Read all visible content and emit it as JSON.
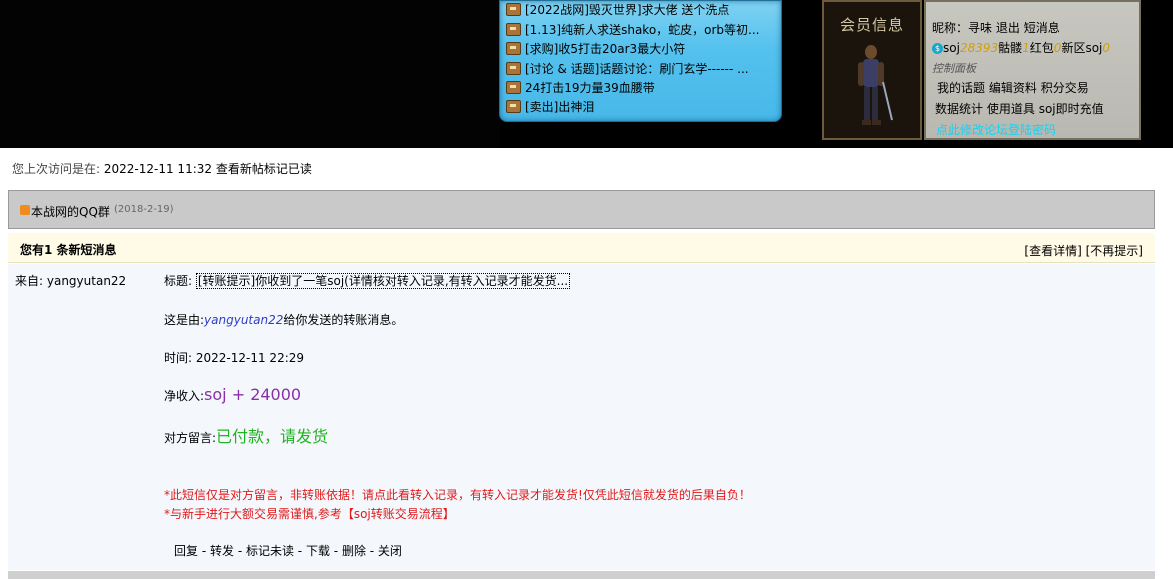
{
  "news": {
    "items": [
      "[2022战网]毁灭世界]求大佬 送个洗点",
      "[1.13]纯新人求送shako，蛇皮，orb等初...",
      "[求购]收5打击20ar3最大小符",
      "[讨论 & 话题]话题讨论：刷门玄学------ ...",
      "24打击19力量39血腰带",
      "[卖出]出神泪"
    ]
  },
  "member_panel": {
    "title": "会员信息",
    "nickname_label": "昵称：",
    "nickname": "寻味",
    "logout": "退出",
    "messages": "短消息",
    "soj_label": "soj",
    "soj_value": "28393",
    "skull_label": "骷髅",
    "skull_value": "1",
    "hongbao_label": "红包",
    "hongbao_value": "0",
    "newzone_label": "新区soj",
    "newzone_value": "0",
    "control_label": "控制面板",
    "links_row1": [
      "我的话题",
      "编辑资料",
      "积分交易"
    ],
    "links_row2": [
      "数据统计",
      "使用道具",
      "soj即时充值"
    ],
    "bottom_link": "点此修改论坛登陆密码"
  },
  "last_visit": {
    "label": "您上次访问是在:",
    "time": "2022-12-11 11:32",
    "action1": "查看新帖",
    "action2": "标记已读"
  },
  "qq_group": {
    "text": "本战网的QQ群",
    "date": "(2018-2-19)"
  },
  "message": {
    "header_title": "您有1 条新短消息",
    "view_detail": "[查看详情]",
    "no_remind": "[不再提示]",
    "from_label": "来自:",
    "from_user": "yangyutan22",
    "subject_label": "标题:",
    "subject": "[转账提示]你收到了一笔soj(详情核对转入记录,有转入记录才能发货...",
    "sender_line_prefix": "这是由:",
    "sender_name": "yangyutan22",
    "sender_line_suffix": "给你发送的转账消息。",
    "time_label": "时间:",
    "time": "2022-12-11 22:29",
    "income_label": "净收入:",
    "income_value": "soj + 24000",
    "remark_label": "对方留言:",
    "remark_value": "已付款，请发货",
    "warning1": "*此短信仅是对方留言，非转账依据！请点此看转入记录，有转入记录才能发货!仅凭此短信就发货的后果自负！",
    "warning2": "*与新手进行大额交易需谨慎,参考【soj转账交易流程】",
    "ops": [
      "回复",
      "转发",
      "标记未读",
      "下载",
      "删除",
      "关闭"
    ]
  }
}
